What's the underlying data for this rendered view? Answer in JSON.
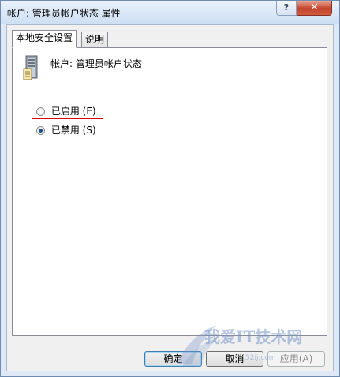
{
  "window": {
    "title": "帐户: 管理员帐户状态 属性",
    "help_glyph": "?",
    "close_glyph": "✕"
  },
  "tabs": [
    {
      "label": "本地安全设置",
      "active": true
    },
    {
      "label": "说明",
      "active": false
    }
  ],
  "policy": {
    "icon": "server-icon",
    "label": "帐户: 管理员帐户状态"
  },
  "options": [
    {
      "label": "已启用 (E)",
      "checked": false
    },
    {
      "label": "已禁用 (S)",
      "checked": true
    }
  ],
  "buttons": {
    "ok": "确定",
    "cancel": "取消",
    "apply": "应用(A)"
  },
  "watermark": {
    "text": "我爱IT技术网",
    "url": "52ij.com"
  }
}
